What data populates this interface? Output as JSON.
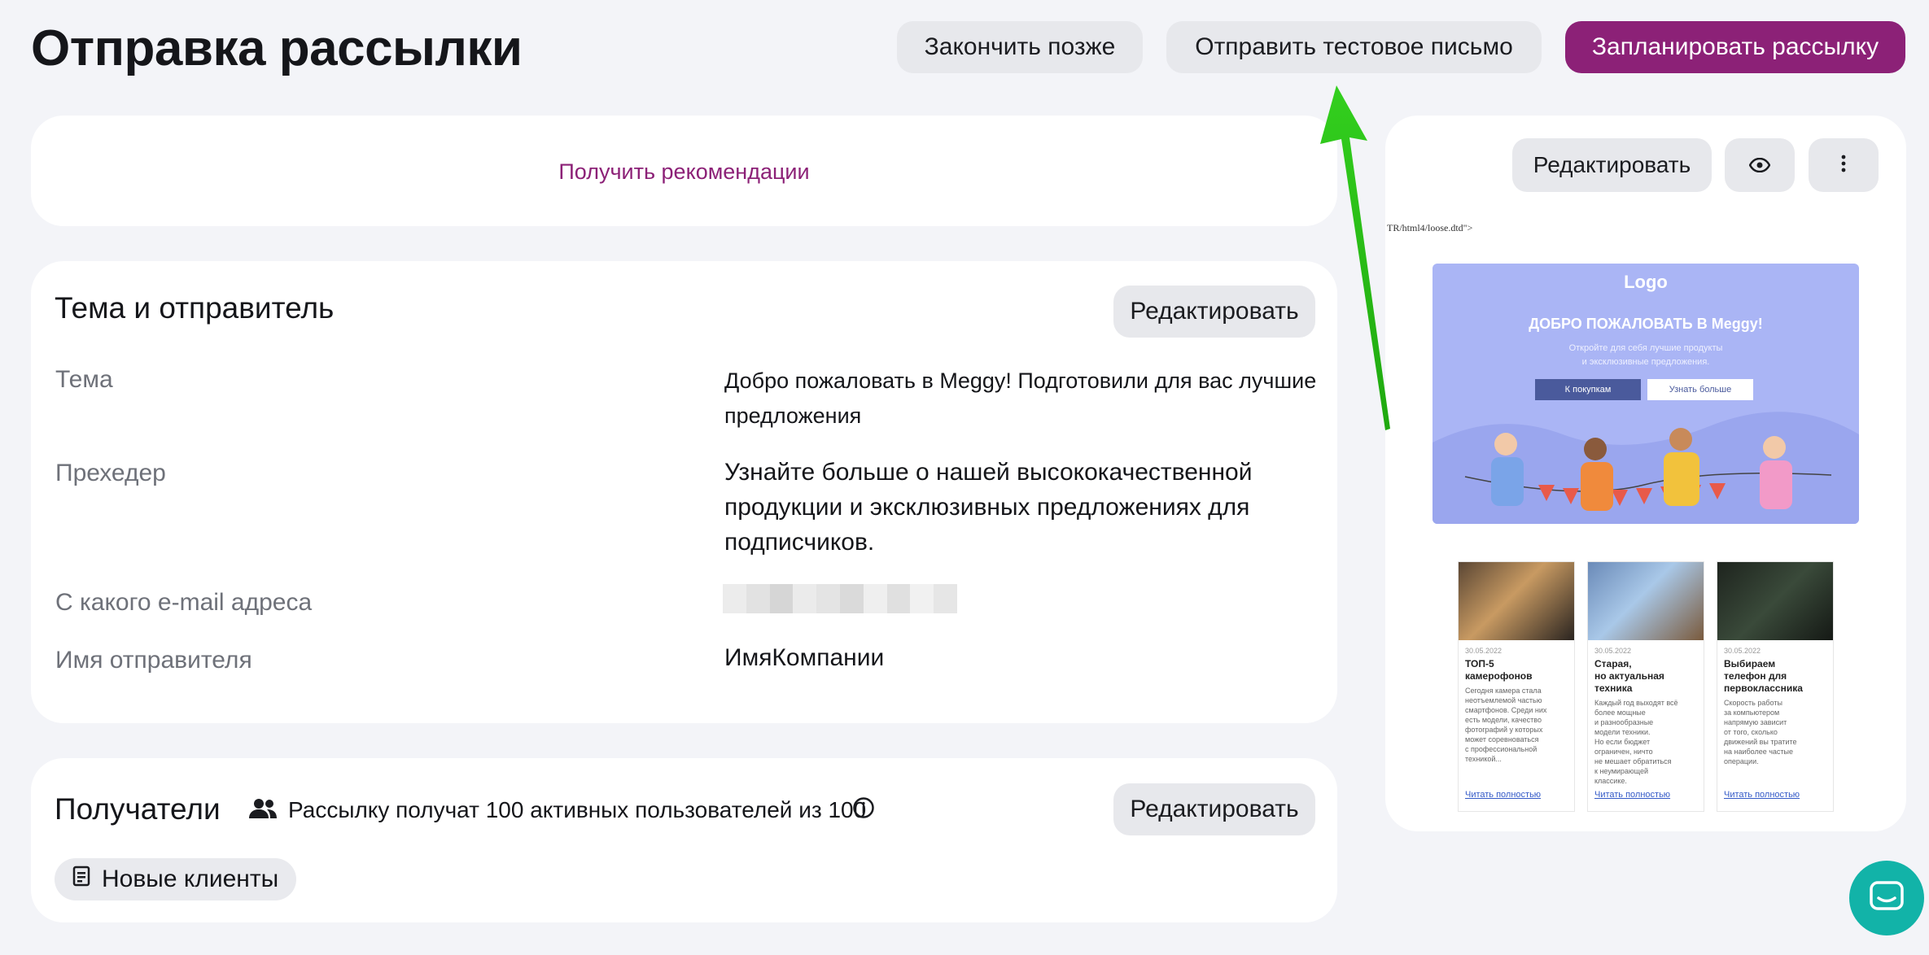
{
  "header": {
    "title": "Отправка рассылки",
    "finish_later": "Закончить позже",
    "send_test": "Отправить тестовое письмо",
    "schedule": "Запланировать рассылку"
  },
  "recommendations": {
    "link": "Получить рекомендации"
  },
  "subject_sender": {
    "title": "Тема и отправитель",
    "edit": "Редактировать",
    "subject_label": "Тема",
    "subject_value": "Добро пожаловать в Meggy! Подготовили для вас лучшие предложения",
    "preheader_label": "Прехедер",
    "preheader_value": "Узнайте больше о нашей высококачественной продукции и эксклюзивных предложениях для подписчиков.",
    "email_label": "С какого e-mail адреса",
    "sender_label": "Имя отправителя",
    "sender_value": "ИмяКомпании"
  },
  "recipients": {
    "title": "Получатели",
    "summary": "Рассылку получат 100 активных пользователей из 100",
    "edit": "Редактировать",
    "segment": "Новые клиенты"
  },
  "preview": {
    "edit": "Редактировать",
    "doctype_text": "TR/html4/loose.dtd\">",
    "hero_logo": "Logo",
    "hero_title": "ДОБРО ПОЖАЛОВАТЬ В Meggy!",
    "hero_subtitle": "Откройте для себя лучшие продукты\nи эксклюзивные предложения.",
    "hero_button_1": "К покупкам",
    "hero_button_2": "Узнать больше",
    "articles": [
      {
        "date": "30.05.2022",
        "title": "ТОП-5\nкамерофонов",
        "body": "Сегодня камера стала\nнеотъемлемой частью\nсмартфонов. Среди них\nесть модели, качество\nфотографий у которых\nможет соревноваться\nс профессиональной\nтехникой...",
        "more": "Читать полностью"
      },
      {
        "date": "30.05.2022",
        "title": "Старая,\nно актуальная\nтехника",
        "body": "Каждый год выходят всё\nболее мощные\nи разнообразные\nмодели техники.\nНо если бюджет\nограничен, ничто\nне мешает обратиться\nк неумирающей\nклассике.",
        "more": "Читать полностью"
      },
      {
        "date": "30.05.2022",
        "title": "Выбираем\nтелефон для\nпервоклассника",
        "body": "Скорость работы\nза компьютером\nнапрямую зависит\nот того, сколько\nдвижений вы тратите\nна наиболее частые\nоперации.",
        "more": "Читать полностью"
      }
    ]
  },
  "colors": {
    "accent": "#8c2177",
    "arrow": "#2ec21c",
    "chat": "#12b3a8",
    "hero_bg": "#aab5f5"
  }
}
